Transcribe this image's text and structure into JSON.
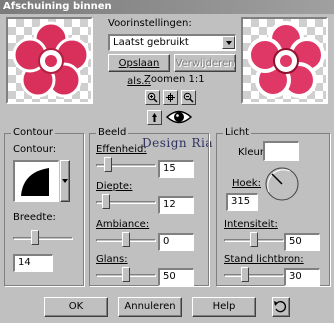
{
  "window": {
    "title": "Afschuining binnen"
  },
  "top": {
    "presets_label": "Voorinstellingen:",
    "preset_value": "Laatst gebruikt",
    "save_as": "Opslaan als...",
    "delete": "Verwijderen",
    "zoom_label": "Zoomen 1:1"
  },
  "watermark": "Design Ria",
  "contour": {
    "title": "Contour",
    "label": "Contour:",
    "width_label": "Breedte:",
    "width_value": "14",
    "width_fraction": 0.35
  },
  "image": {
    "title": "Beeld",
    "smoothness": {
      "label": "Effenheid:",
      "value": "15",
      "fraction": 0.15
    },
    "depth": {
      "label": "Diepte:",
      "value": "12",
      "fraction": 0.12
    },
    "ambience": {
      "label": "Ambiance:",
      "value": "0",
      "fraction": 0.5
    },
    "gloss": {
      "label": "Glans:",
      "value": "50",
      "fraction": 0.5
    }
  },
  "light": {
    "title": "Licht",
    "color_label": "Kleur:",
    "color": "#ffffff",
    "angle_label": "Hoek:",
    "angle_value": "315",
    "intensity": {
      "label": "Intensiteit:",
      "value": "50",
      "fraction": 0.5
    },
    "elevation": {
      "label": "Stand lichtbron:",
      "value": "30",
      "fraction": 0.33
    }
  },
  "buttons": {
    "ok": "OK",
    "cancel": "Annuleren",
    "help": "Help"
  },
  "icons": {
    "zoom_in": "zoom-in-icon",
    "pan": "pan-icon",
    "zoom_out": "zoom-out-icon",
    "proof": "proof-icon",
    "eye": "eye-icon",
    "reset": "reset-icon"
  },
  "colors": {
    "flower": "#d8305a",
    "flower_light": "#ffffff"
  }
}
